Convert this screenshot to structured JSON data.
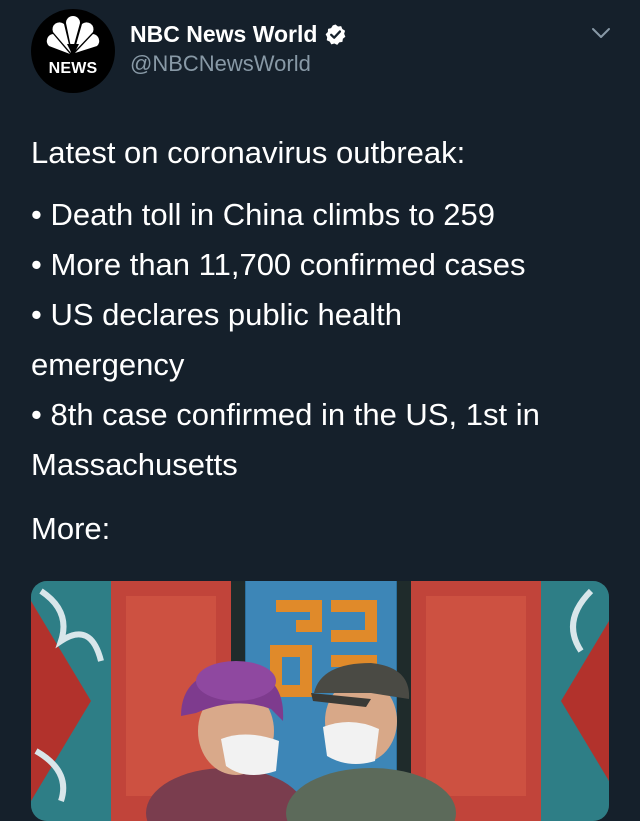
{
  "author": {
    "display_name": "NBC News World",
    "handle": "@NBCNewsWorld",
    "avatar_label": "NEWS",
    "verified": true
  },
  "tweet": {
    "intro": "Latest on coronavirus outbreak:",
    "bullets": [
      "• Death toll in China climbs to 259",
      "• More than 11,700 confirmed cases",
      "• US declares public health",
      "emergency",
      "• 8th case confirmed in the US, 1st in",
      "Massachusetts"
    ],
    "more_label": "More:"
  },
  "colors": {
    "background": "#15202b",
    "text": "#ffffff",
    "secondary_text": "#8899a6",
    "verified_badge": "#ffffff"
  },
  "icons": {
    "verified": "verified-badge-icon",
    "menu": "chevron-down-icon",
    "avatar": "nbc-peacock-logo"
  }
}
